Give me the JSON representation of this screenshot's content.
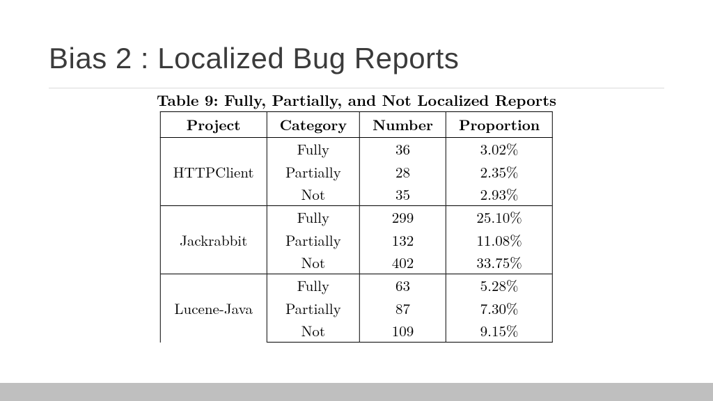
{
  "title": "Bias 2 : Localized Bug Reports",
  "table_caption": "Table 9: Fully, Partially, and Not Localized Reports",
  "columns": [
    "Project",
    "Category",
    "Number",
    "Proportion"
  ],
  "groups": [
    {
      "project": "HTTPClient",
      "rows": [
        {
          "category": "Fully",
          "number": "36",
          "proportion": "3.02%"
        },
        {
          "category": "Partially",
          "number": "28",
          "proportion": "2.35%"
        },
        {
          "category": "Not",
          "number": "35",
          "proportion": "2.93%"
        }
      ]
    },
    {
      "project": "Jackrabbit",
      "rows": [
        {
          "category": "Fully",
          "number": "299",
          "proportion": "25.10%"
        },
        {
          "category": "Partially",
          "number": "132",
          "proportion": "11.08%"
        },
        {
          "category": "Not",
          "number": "402",
          "proportion": "33.75%"
        }
      ]
    },
    {
      "project": "Lucene-Java",
      "rows": [
        {
          "category": "Fully",
          "number": "63",
          "proportion": "5.28%"
        },
        {
          "category": "Partially",
          "number": "87",
          "proportion": "7.30%"
        },
        {
          "category": "Not",
          "number": "109",
          "proportion": "9.15%"
        }
      ]
    }
  ],
  "chart_data": {
    "type": "table",
    "title": "Fully, Partially, and Not Localized Reports",
    "columns": [
      "Project",
      "Category",
      "Number",
      "Proportion"
    ],
    "rows": [
      [
        "HTTPClient",
        "Fully",
        36,
        "3.02%"
      ],
      [
        "HTTPClient",
        "Partially",
        28,
        "2.35%"
      ],
      [
        "HTTPClient",
        "Not",
        35,
        "2.93%"
      ],
      [
        "Jackrabbit",
        "Fully",
        299,
        "25.10%"
      ],
      [
        "Jackrabbit",
        "Partially",
        132,
        "11.08%"
      ],
      [
        "Jackrabbit",
        "Not",
        402,
        "33.75%"
      ],
      [
        "Lucene-Java",
        "Fully",
        63,
        "5.28%"
      ],
      [
        "Lucene-Java",
        "Partially",
        87,
        "7.30%"
      ],
      [
        "Lucene-Java",
        "Not",
        109,
        "9.15%"
      ]
    ]
  }
}
